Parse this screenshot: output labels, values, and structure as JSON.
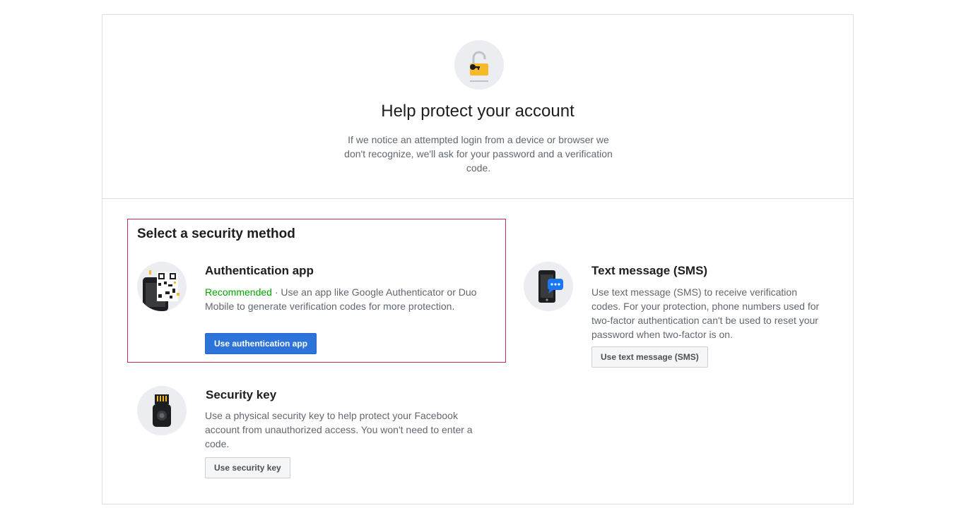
{
  "header": {
    "title": "Help protect your account",
    "description": "If we notice an attempted login from a device or browser we don't recognize, we'll ask for your password and a verification code."
  },
  "section": {
    "title": "Select a security method"
  },
  "methods": {
    "auth_app": {
      "title": "Authentication app",
      "badge": "Recommended",
      "description": " · Use an app like Google Authenticator or Duo Mobile to generate verification codes for more protection.",
      "button": "Use authentication app"
    },
    "sms": {
      "title": "Text message (SMS)",
      "description": "Use text message (SMS) to receive verification codes. For your protection, phone numbers used for two-factor authentication can't be used to reset your password when two-factor is on.",
      "button": "Use text message (SMS)"
    },
    "security_key": {
      "title": "Security key",
      "description": "Use a physical security key to help protect your Facebook account from unauthorized access. You won't need to enter a code.",
      "button": "Use security key"
    }
  },
  "icons": {
    "header": "padlock-key-icon",
    "auth_app": "qr-phone-icon",
    "sms": "phone-chat-icon",
    "security_key": "usb-key-icon"
  },
  "colors": {
    "primary_button": "#2d74da",
    "recommended": "#00a400",
    "highlight_border": "#c7304d",
    "icon_lock": "#f7b928"
  }
}
